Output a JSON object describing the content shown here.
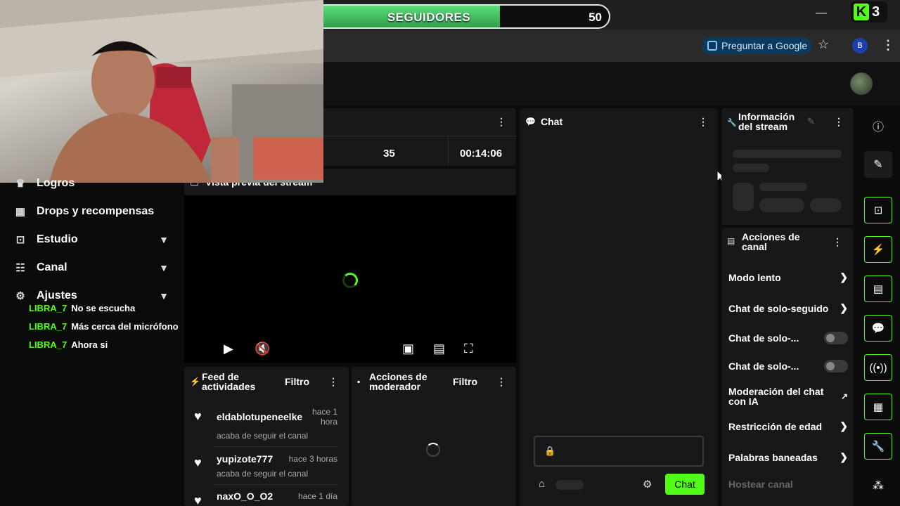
{
  "goal": {
    "current": "35",
    "label": "SEGUIDORES",
    "target": "50",
    "progress_fraction": 0.7
  },
  "browser": {
    "ask_google": "Preguntar a Google",
    "profile_initial": "B",
    "kick_badge_number": "3"
  },
  "stats": {
    "followers": "35",
    "uptime": "00:14:06"
  },
  "sidebar": {
    "items": [
      {
        "label": "Logros",
        "icon": "trophy-icon"
      },
      {
        "label": "Drops y recompensas",
        "icon": "gift-icon"
      },
      {
        "label": "Estudio",
        "icon": "studio-icon",
        "expandable": true
      },
      {
        "label": "Canal",
        "icon": "channel-icon",
        "expandable": true
      },
      {
        "label": "Ajustes",
        "icon": "gear-icon",
        "expandable": true
      }
    ]
  },
  "overlay_chat": [
    {
      "user": "LIBRA_7",
      "text": "No se escucha"
    },
    {
      "user": "LIBRA_7",
      "text": "Más cerca del micrófono"
    },
    {
      "user": "LIBRA_7",
      "text": "Ahora si"
    }
  ],
  "preview": {
    "title": "Vista previa del stream"
  },
  "chat": {
    "title": "Chat",
    "send_label": "Chat"
  },
  "feed": {
    "title_line1": "Feed de",
    "title_line2": "actividades",
    "filter_label": "Filtro",
    "items": [
      {
        "user": "eldablotupeneelke",
        "time_line1": "hace 1",
        "time_line2": "hora",
        "action": "acaba de seguir el canal"
      },
      {
        "user": "yupizote777",
        "time_line1": "hace 3 horas",
        "time_line2": "",
        "action": "acaba de seguir el canal"
      },
      {
        "user": "naxO_O_O2",
        "time_line1": "hace 1 día",
        "time_line2": "",
        "action": ""
      }
    ]
  },
  "mod_actions": {
    "title_line1": "Acciones de",
    "title_line2": "moderador",
    "filter_label": "Filtro"
  },
  "stream_info": {
    "title_line1": "Información",
    "title_line2": "del stream"
  },
  "channel_actions": {
    "title_line1": "Acciones de",
    "title_line2": "canal",
    "slow_mode": "Modo lento",
    "followers_only": "Chat de solo-seguido",
    "subs_only_1": "Chat de solo-...",
    "subs_only_2": "Chat de solo-...",
    "ai_mod_line1": "Moderación del chat",
    "ai_mod_line2": "con IA",
    "age_restriction": "Restricción de edad",
    "banned_words": "Palabras baneadas",
    "host_channel": "Hostear canal"
  },
  "colors": {
    "accent": "#53fc18",
    "panel": "#18181a",
    "background": "#0b0b0c"
  }
}
